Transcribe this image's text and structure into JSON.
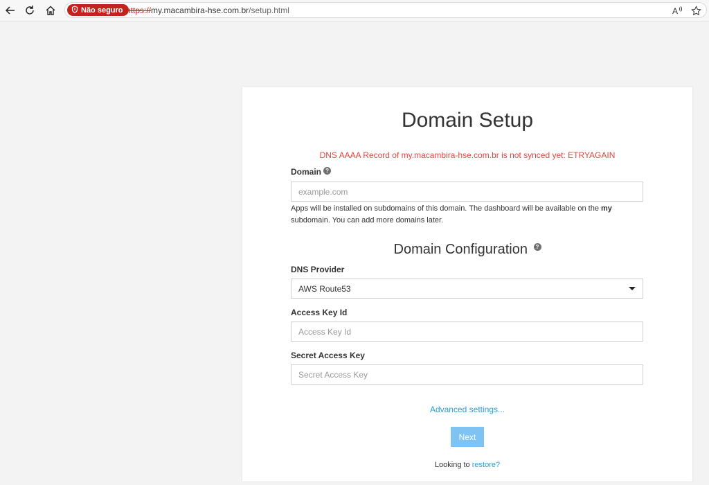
{
  "browser": {
    "insecure_label": "Não seguro",
    "url_scheme": "https://",
    "url_host": "my.macambira-hse.com.br",
    "url_path": "/setup.html",
    "icons": [
      "back-icon",
      "reload-icon",
      "home-icon",
      "shield-icon",
      "read-aloud-icon",
      "favorite-star-icon"
    ]
  },
  "page": {
    "title": "Domain Setup",
    "error": "DNS AAAA Record of my.macambira-hse.com.br is not synced yet: ETRYAGAIN",
    "domain": {
      "label": "Domain",
      "placeholder": "example.com",
      "help_pre": "Apps will be installed on subdomains of this domain. The dashboard will be available on the ",
      "help_bold": "my",
      "help_post": " subdomain. You can add more domains later."
    },
    "config": {
      "title": "Domain Configuration",
      "dns_provider_label": "DNS Provider",
      "dns_provider_value": "AWS Route53",
      "access_key_label": "Access Key Id",
      "access_key_placeholder": "Access Key Id",
      "secret_key_label": "Secret Access Key",
      "secret_key_placeholder": "Secret Access Key"
    },
    "advanced_link": "Advanced settings...",
    "next_button": "Next",
    "restore_prefix": "Looking to ",
    "restore_link": "restore?"
  },
  "colors": {
    "error": "#e8453c",
    "link": "#2a9fd6",
    "button": "#7ec3f2",
    "insecure_badge": "#c5221f"
  }
}
